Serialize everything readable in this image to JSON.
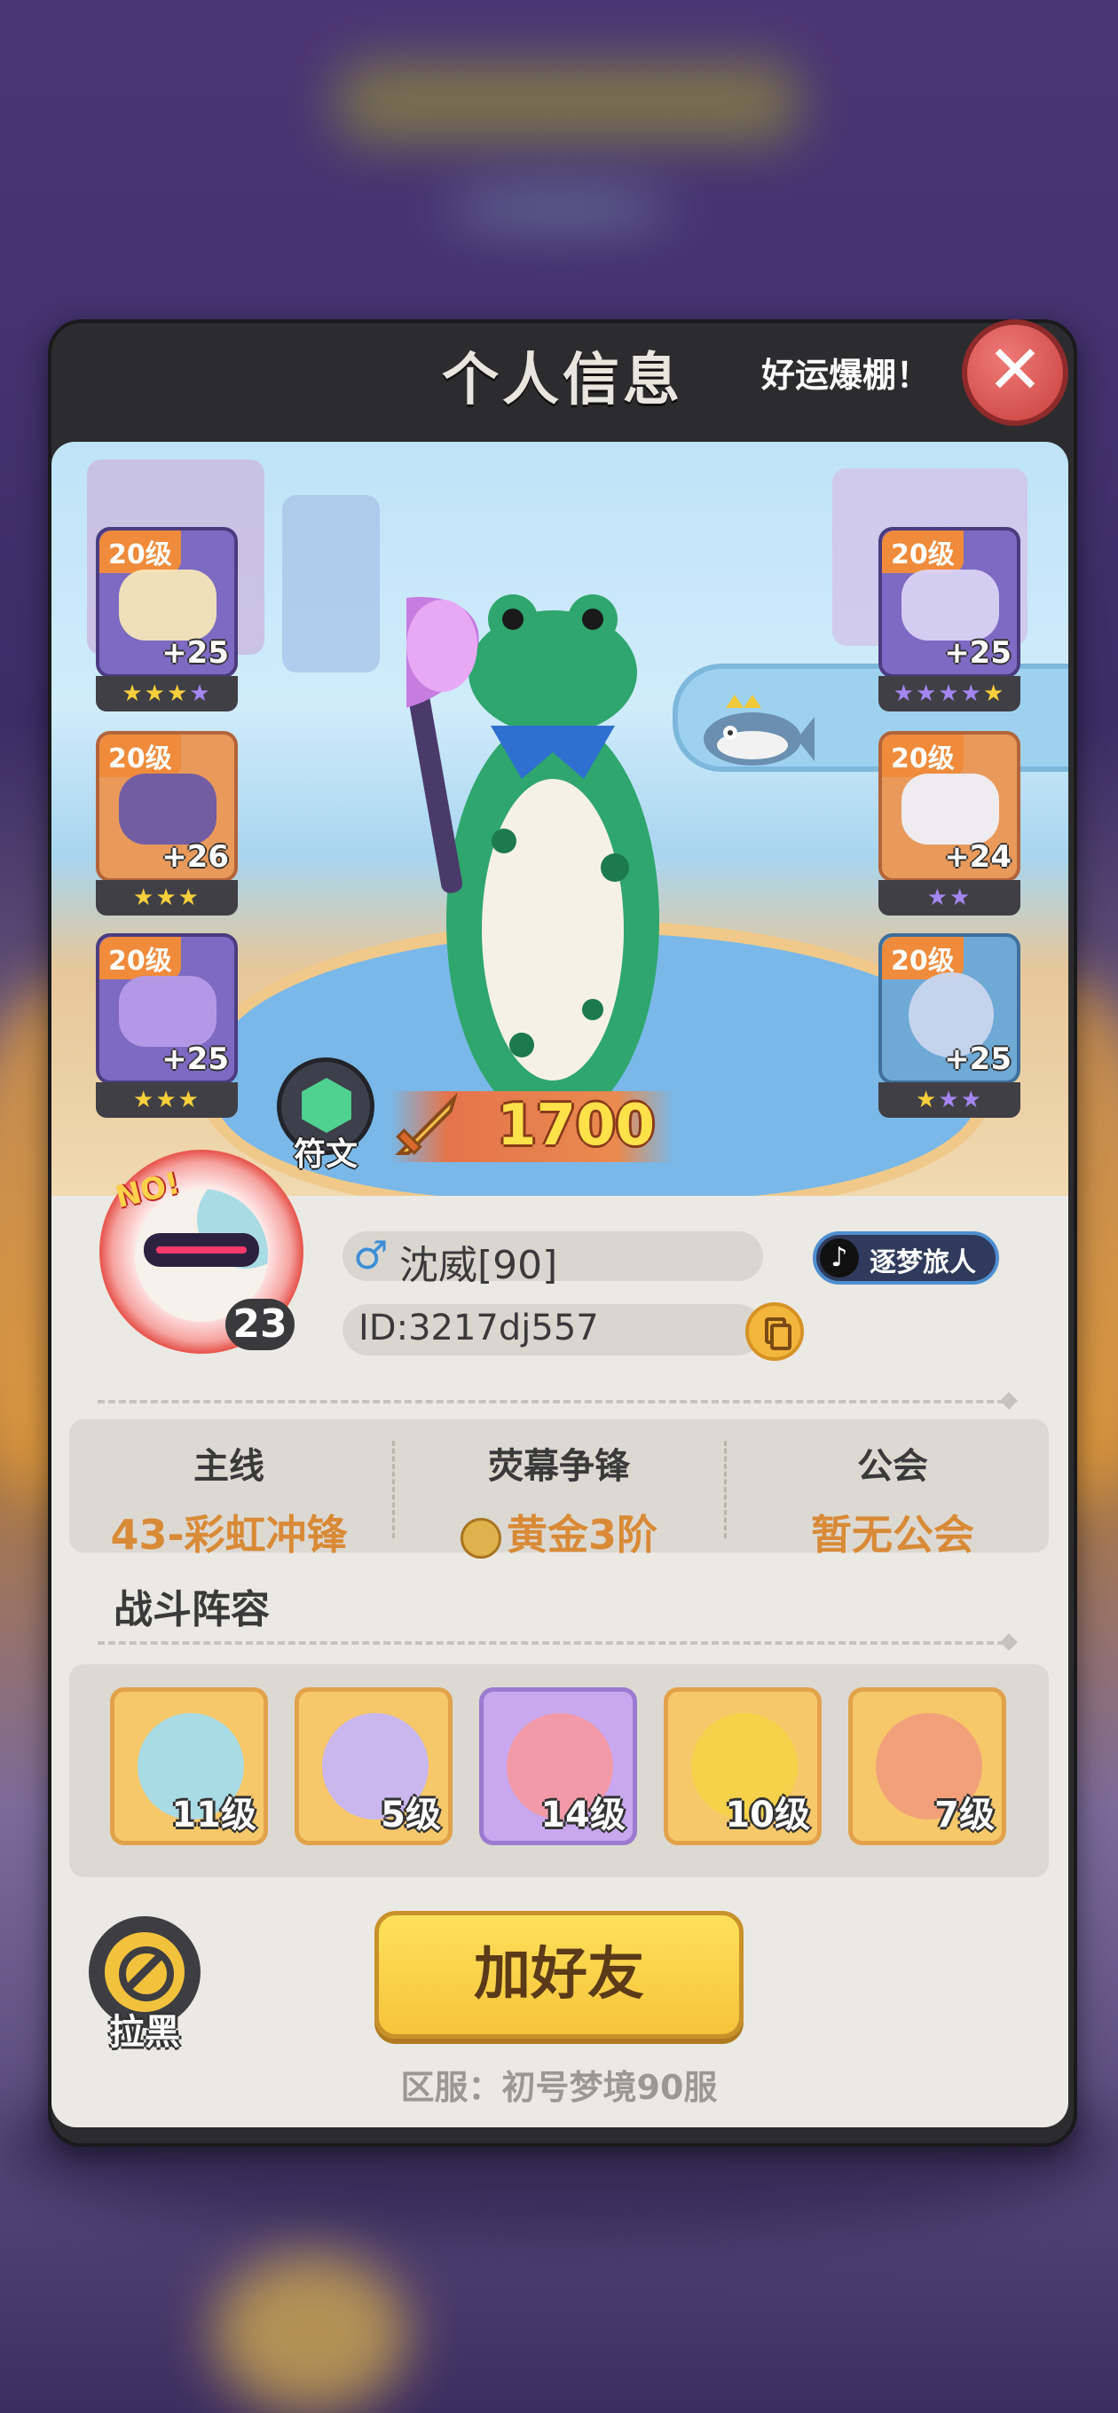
{
  "modal": {
    "title": "个人信息",
    "marquee": "好运爆棚！",
    "close_label": "✕"
  },
  "equipment_left": [
    {
      "level": "20级",
      "bonus": "+25",
      "stars": [
        "gold",
        "gold",
        "gold",
        "purple"
      ]
    },
    {
      "level": "20级",
      "bonus": "+26",
      "stars": [
        "gold",
        "gold",
        "gold"
      ]
    },
    {
      "level": "20级",
      "bonus": "+25",
      "stars": [
        "gold",
        "gold",
        "gold"
      ]
    }
  ],
  "equipment_right": [
    {
      "level": "20级",
      "bonus": "+25",
      "stars": [
        "purple",
        "purple",
        "purple",
        "purple",
        "gold"
      ]
    },
    {
      "level": "20级",
      "bonus": "+24",
      "stars": [
        "purple",
        "purple"
      ]
    },
    {
      "level": "20级",
      "bonus": "+25",
      "stars": [
        "gold",
        "purple",
        "purple"
      ]
    }
  ],
  "rune": {
    "label": "符文",
    "icon": "hexagon-gem-icon"
  },
  "combat_power": {
    "value": "1700",
    "icon": "sword-icon"
  },
  "player": {
    "avatar_level": "23",
    "gender_symbol": "♂",
    "name": "沈威[90]",
    "id": "ID:3217dj557",
    "badge": "逐梦旅人"
  },
  "stats": [
    {
      "heading": "主线",
      "value": "43-彩虹冲锋"
    },
    {
      "heading": "荧幕争锋",
      "value": "黄金3阶"
    },
    {
      "heading": "公会",
      "value": "暂无公会"
    }
  ],
  "lineup": {
    "title": "战斗阵容",
    "heroes": [
      {
        "level": "11级",
        "color": "#a9dbe5"
      },
      {
        "level": "5级",
        "color": "#c9b7ee"
      },
      {
        "level": "14级",
        "color": "#f29aa8"
      },
      {
        "level": "10级",
        "color": "#f5d24a"
      },
      {
        "level": "7级",
        "color": "#f2a07a"
      }
    ]
  },
  "actions": {
    "block_label": "拉黑",
    "add_friend_label": "加好友"
  },
  "server": "区服：初号梦境90服",
  "colors": {
    "accent_orange": "#d98a36",
    "button_yellow": "#f6c43b",
    "close_red": "#c9403d"
  }
}
